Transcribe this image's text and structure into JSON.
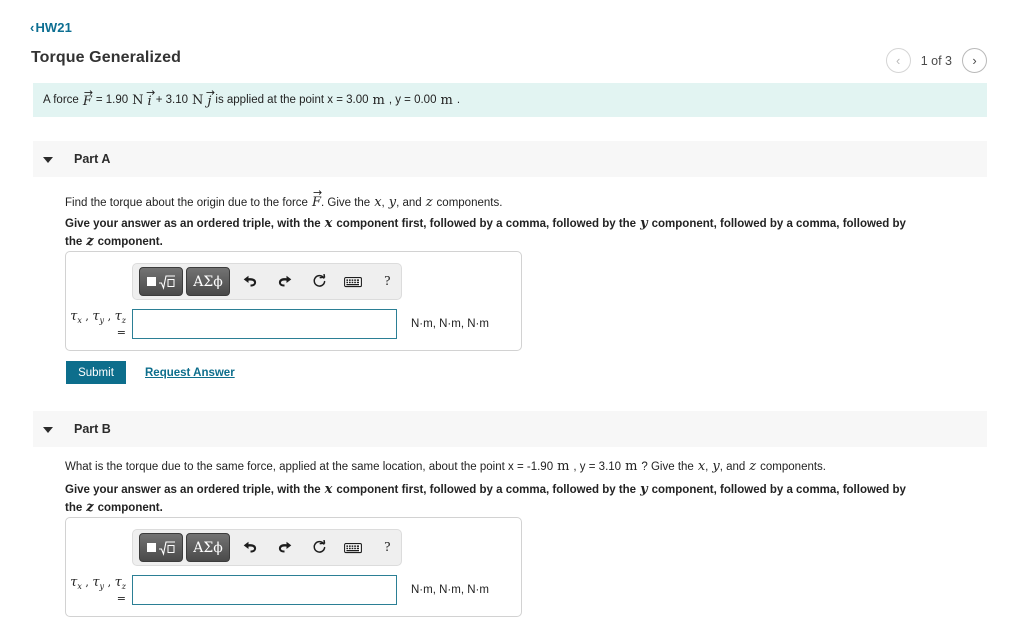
{
  "breadcrumb": {
    "icon": "chevron-left-icon",
    "chevron": "‹",
    "label": "HW21"
  },
  "header": {
    "title": "Torque Generalized"
  },
  "pager": {
    "prev_icon": "chevron-left-icon",
    "prev_glyph": "‹",
    "next_icon": "chevron-right-icon",
    "next_glyph": "›",
    "label": "1 of 3"
  },
  "statement": {
    "prefix": "A force",
    "force_symbol": "F",
    "eq1": "= 1.90",
    "unit_n1": "N",
    "ihat": "i",
    "plus": "+ 3.10",
    "unit_n2": "N",
    "jhat": "j",
    "middle": "is applied at the point x = 3.00",
    "unit_m1": "m",
    "y_text": ", y = 0.00",
    "unit_m2": "m",
    "period": "."
  },
  "math_toolbar": {
    "template_button": {
      "name": "math-template-button",
      "radical_glyph": "√"
    },
    "greek_button": {
      "name": "greek-letters-button",
      "label": "ΑΣϕ"
    },
    "undo": {
      "name": "undo-icon",
      "glyph": "↶"
    },
    "redo": {
      "name": "redo-icon",
      "glyph": "↷"
    },
    "reset": {
      "name": "reset-icon",
      "glyph": "↻"
    },
    "keyboard": {
      "name": "keyboard-icon",
      "glyph": "⌨"
    },
    "help": {
      "name": "help-icon",
      "glyph": "?"
    }
  },
  "parts": [
    {
      "id": "part-a",
      "title": "Part A",
      "caret_icon": "caret-down-icon",
      "question": {
        "lead": "Find the torque about the origin due to the force",
        "force_symbol": "F",
        "tail_1": ". Give the",
        "var_x": "x",
        "comma1": ",",
        "var_y": "y",
        "and": ", and",
        "var_z": "z",
        "tail_2": "components."
      },
      "instruction": {
        "seg1": "Give your answer as an ordered triple, with the",
        "x": "x",
        "seg2": "component first, followed by a comma, followed by the",
        "y": "y",
        "seg3": "component, followed by a comma, followed by the",
        "z": "z",
        "seg4": "component."
      },
      "answer": {
        "label_tau_x": "τ",
        "label": "τx , τy , τz  =",
        "value": "",
        "placeholder": "",
        "units": "N·m, N·m, N·m"
      },
      "actions": {
        "submit_label": "Submit",
        "request_label": "Request Answer"
      }
    },
    {
      "id": "part-b",
      "title": "Part B",
      "caret_icon": "caret-down-icon",
      "question": {
        "lead": "What is the torque due to the same force, applied at the same location, about the point x = -1.90",
        "unit_m1": "m",
        "mid": ", y = 3.10",
        "unit_m2": "m",
        "tail_1": "? Give the",
        "var_x": "x",
        "comma1": ",",
        "var_y": "y",
        "and": ", and",
        "var_z": "z",
        "tail_2": "components."
      },
      "instruction": {
        "seg1": "Give your answer as an ordered triple, with the",
        "x": "x",
        "seg2": "component first, followed by a comma, followed by the",
        "y": "y",
        "seg3": "component, followed by a comma, followed by the",
        "z": "z",
        "seg4": "component."
      },
      "answer": {
        "label": "τx , τy , τz  =",
        "value": "",
        "placeholder": "",
        "units": "N·m, N·m, N·m"
      }
    }
  ],
  "colors": {
    "accent_teal": "#0d6e8c",
    "banner_bg": "#e2f4f2",
    "part_header_bg": "#f7f7f7",
    "input_border": "#2b7f95"
  }
}
